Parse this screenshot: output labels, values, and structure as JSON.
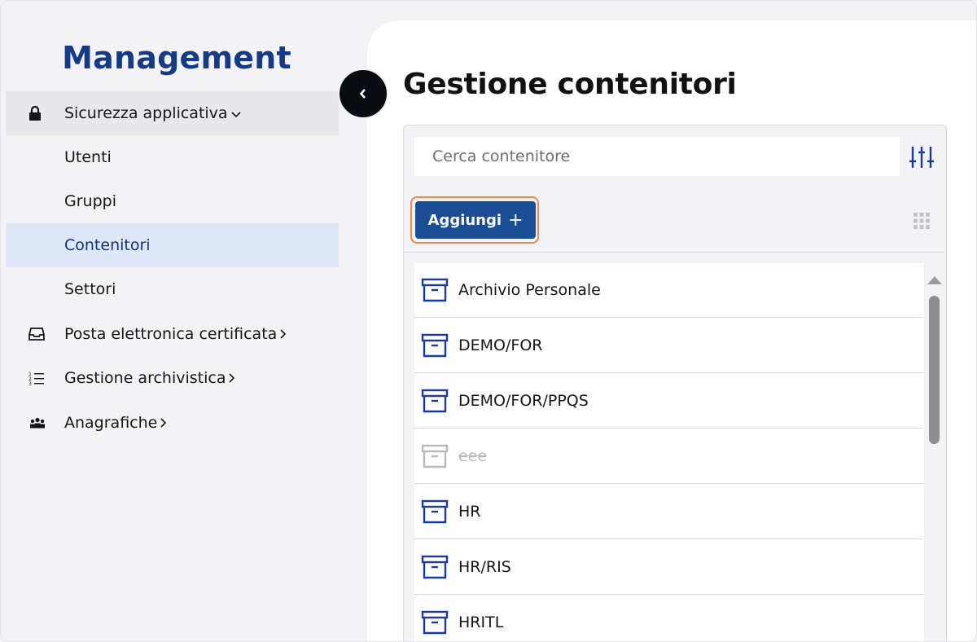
{
  "sidebar": {
    "brand": "Management",
    "items": [
      {
        "label": "Sicurezza applicativa",
        "icon": "lock-icon",
        "expanded": true
      },
      {
        "label": "Utenti"
      },
      {
        "label": "Gruppi"
      },
      {
        "label": "Contenitori",
        "active": true
      },
      {
        "label": "Settori"
      },
      {
        "label": "Posta elettronica certificata",
        "icon": "inbox-icon"
      },
      {
        "label": "Gestione archivistica",
        "icon": "list-icon"
      },
      {
        "label": "Anagrafiche",
        "icon": "people-icon"
      }
    ],
    "collapse_icon": "chevron-left-icon"
  },
  "main": {
    "title": "Gestione contenitori",
    "search_placeholder": "Cerca contenitore",
    "add_label": "Aggiungi",
    "add_icon": "plus-icon",
    "filter_icon": "sliders-icon",
    "grid_icon": "grid-icon",
    "containers": [
      {
        "name": "Archivio Personale",
        "disabled": false
      },
      {
        "name": "DEMO/FOR",
        "disabled": false
      },
      {
        "name": "DEMO/FOR/PPQS",
        "disabled": false
      },
      {
        "name": "eee",
        "disabled": true
      },
      {
        "name": "HR",
        "disabled": false
      },
      {
        "name": "HR/RIS",
        "disabled": false
      },
      {
        "name": "HRITL",
        "disabled": false
      }
    ]
  },
  "colors": {
    "brand": "#173a84",
    "primary_button": "#1a4d94",
    "focus_ring": "#f08653",
    "active_nav": "#dde7f7",
    "icon_blue": "#1a3a9c"
  }
}
